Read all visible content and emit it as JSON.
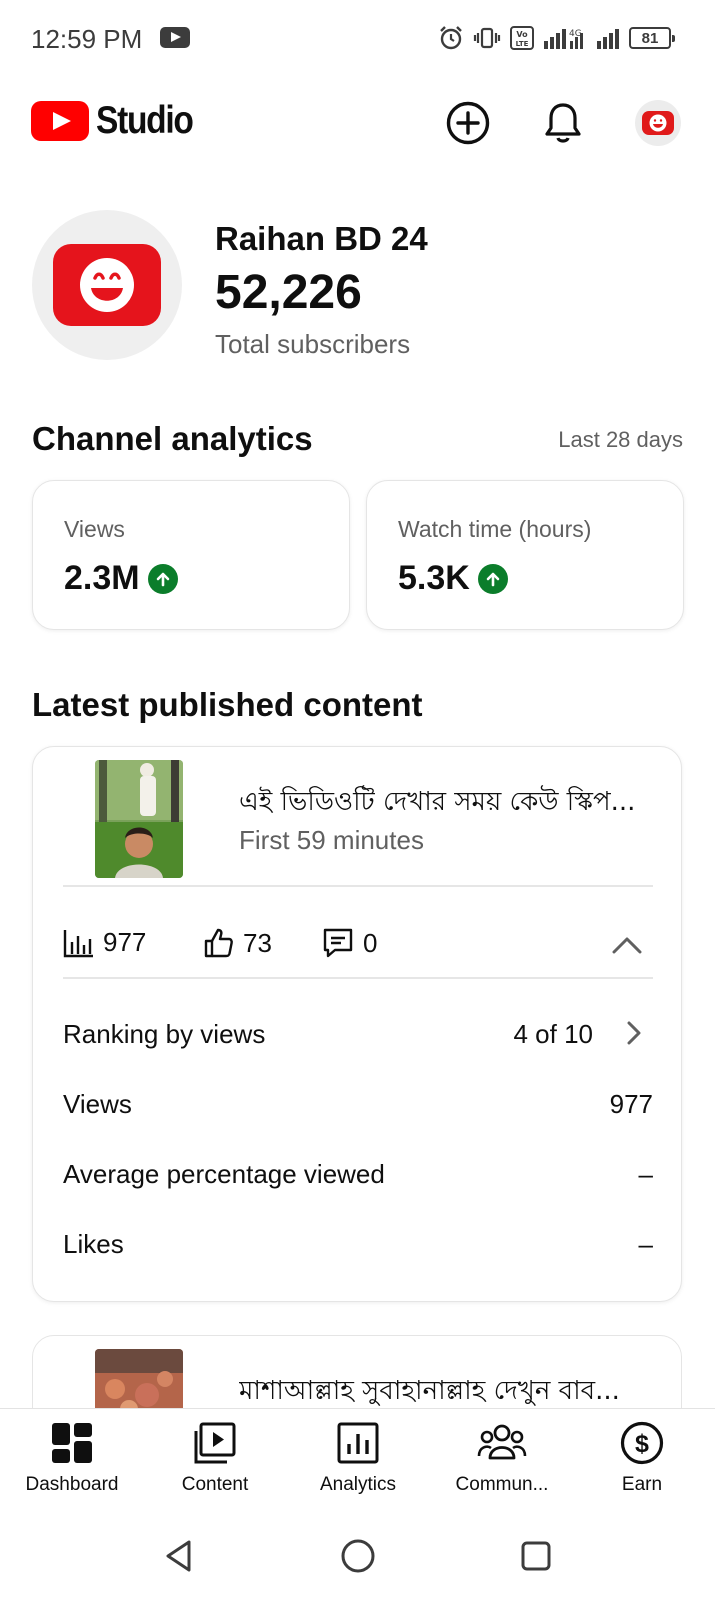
{
  "status_bar": {
    "time": "12:59 PM",
    "battery": "81",
    "icons": [
      "youtube-icon",
      "alarm-icon",
      "vibrate-icon",
      "volte-icon",
      "signal-icon",
      "4g-icon",
      "signal-icon",
      "battery-icon"
    ]
  },
  "header": {
    "logo_text": "Studio",
    "create_icon": "create-plus-icon",
    "notifications_icon": "bell-icon",
    "avatar": "channel-avatar"
  },
  "channel": {
    "name": "Raihan BD 24",
    "subscribers": "52,226",
    "subscribers_label": "Total subscribers"
  },
  "analytics": {
    "title": "Channel analytics",
    "range": "Last 28 days",
    "metrics": [
      {
        "label": "Views",
        "value": "2.3M",
        "trend": "up"
      },
      {
        "label": "Watch time (hours)",
        "value": "5.3K",
        "trend": "up"
      }
    ]
  },
  "latest": {
    "title": "Latest published content",
    "items": [
      {
        "title": "এই ভিডিওটি দেখার সময় কেউ স্কিপ...",
        "subtitle": "First 59 minutes",
        "views": "977",
        "likes": "73",
        "comments": "0",
        "details": [
          {
            "label": "Ranking by views",
            "value": "4 of 10"
          },
          {
            "label": "Views",
            "value": "977"
          },
          {
            "label": "Average percentage viewed",
            "value": "–"
          },
          {
            "label": "Likes",
            "value": "–"
          }
        ]
      },
      {
        "title": "মাশাআল্লাহ সুবাহানাল্লাহ দেখুন বাব..."
      }
    ]
  },
  "bottom_nav": {
    "items": [
      {
        "label": "Dashboard",
        "icon": "dashboard-icon",
        "active": true
      },
      {
        "label": "Content",
        "icon": "content-icon"
      },
      {
        "label": "Analytics",
        "icon": "analytics-icon"
      },
      {
        "label": "Commun...",
        "icon": "community-icon"
      },
      {
        "label": "Earn",
        "icon": "earn-icon"
      }
    ]
  },
  "system_nav": {
    "buttons": [
      "back-icon",
      "home-icon",
      "recents-icon"
    ]
  },
  "colors": {
    "brand_red": "#ff0000",
    "trend_green": "#0b7d2b",
    "secondary_text": "#606060"
  }
}
